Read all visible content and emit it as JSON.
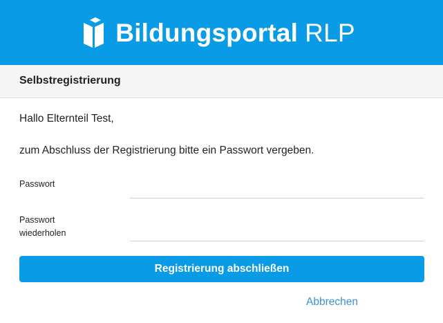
{
  "header": {
    "brand_bold": "Bildungsportal",
    "brand_light": "RLP",
    "logo_icon": "bildungsportal-logo-icon",
    "background_color": "#0a9be6"
  },
  "section": {
    "title": "Selbstregistrierung"
  },
  "content": {
    "greeting": "Hallo Elternteil Test,",
    "instruction": "zum Abschluss der Registrierung bitte ein Passwort vergeben."
  },
  "form": {
    "password_label": "Passwort",
    "password_value": "",
    "password_repeat_label_line1": "Passwort",
    "password_repeat_label_line2": "wiederholen",
    "password_repeat_value": "",
    "submit_label": "Registrierung abschließen",
    "cancel_label": "Abbrechen"
  },
  "colors": {
    "primary": "#0a9be6",
    "link": "#3a8fd6",
    "header_band": "#f5f5f5"
  }
}
